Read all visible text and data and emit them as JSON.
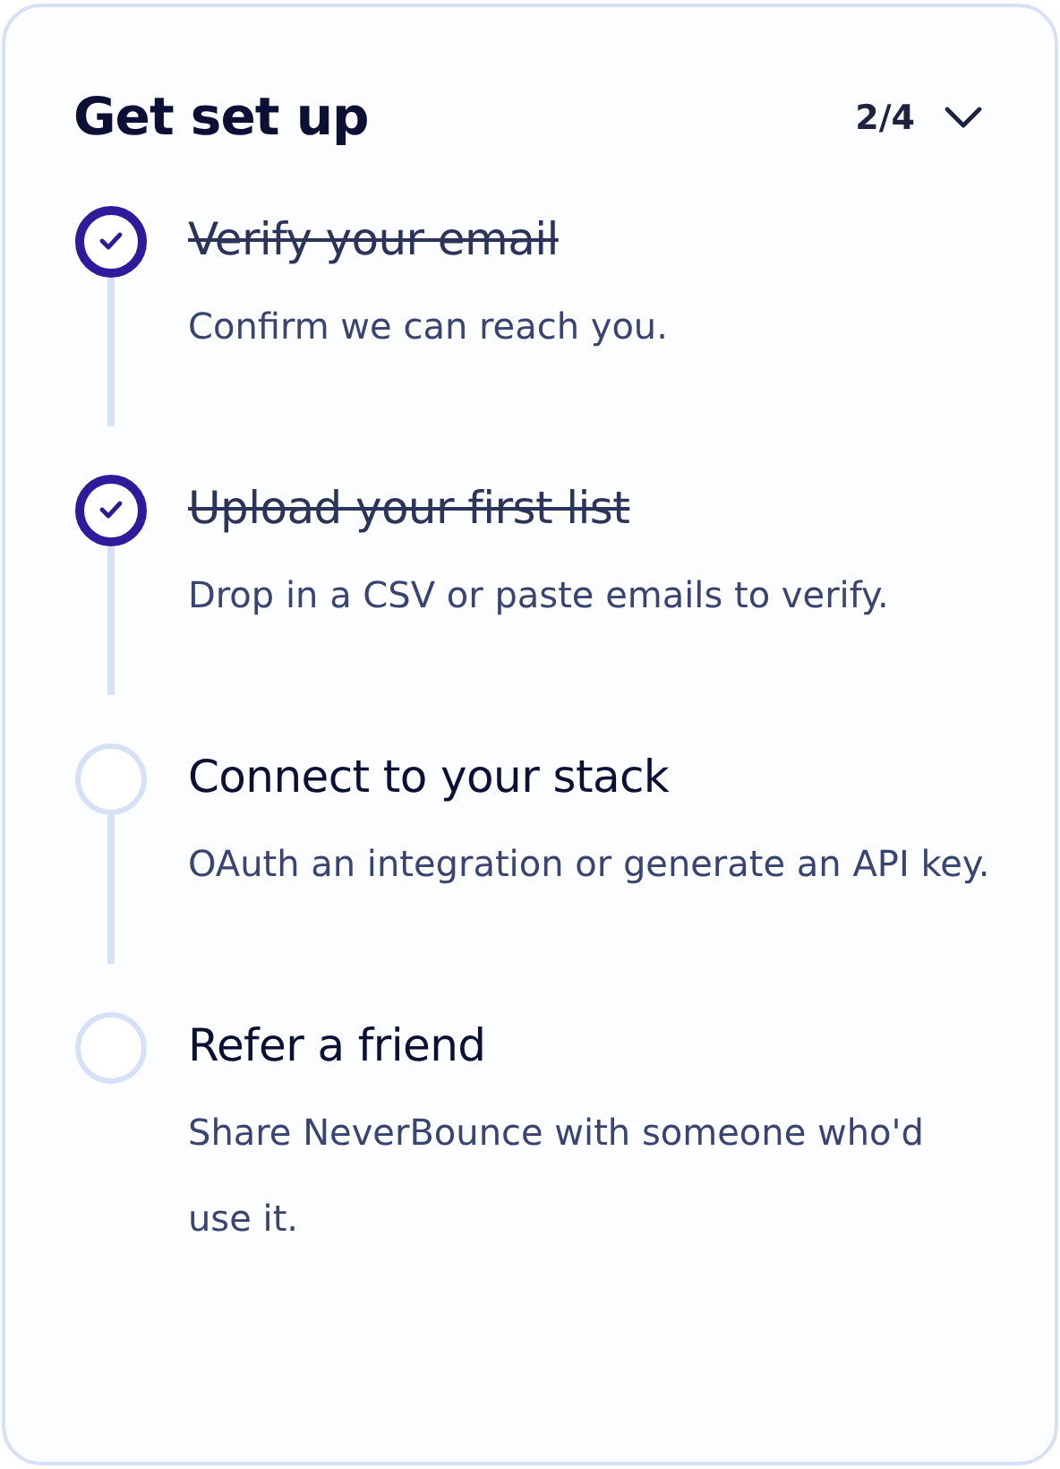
{
  "title": "Get set up",
  "progress": "2/4",
  "expanded": true,
  "steps": [
    {
      "title": "Verify your email",
      "description": "Confirm we can reach you.",
      "done": true
    },
    {
      "title": "Upload your first list",
      "description": "Drop in a CSV or paste emails to verify.",
      "done": true
    },
    {
      "title": "Connect to your stack",
      "description": "OAuth an integration or generate an API key.",
      "done": false
    },
    {
      "title": "Refer a friend",
      "description": "Share NeverBounce with someone who'd use it.",
      "done": false
    }
  ]
}
